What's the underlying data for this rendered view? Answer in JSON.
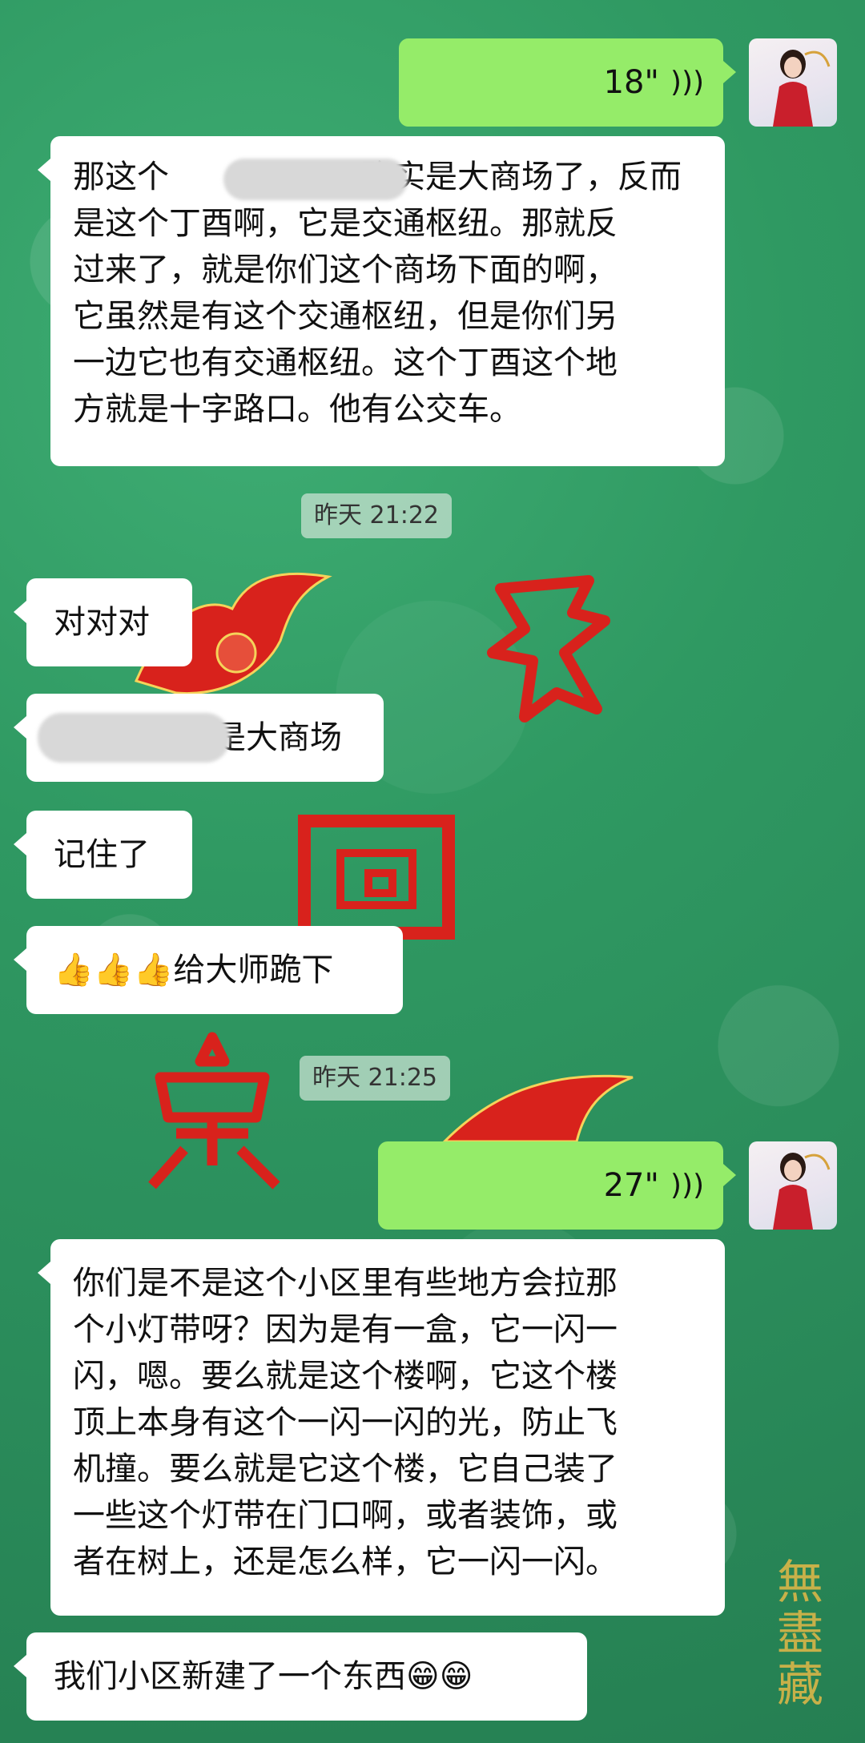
{
  "chat": {
    "messages": [
      {
        "side": "sent",
        "type": "voice",
        "duration": "18\""
      },
      {
        "side": "recv",
        "type": "text",
        "text": "那这个确实是大商场了，反而是这个丁酉啊，它是交通枢纽。那就反过来了，就是你们这个商场下面的啊，它虽然是有这个交通枢纽，但是你们另一边它也有交通枢纽。这个丁酉这个地方就是十字路口。他有公交车。"
      },
      {
        "side": "time",
        "text": "昨天 21:22"
      },
      {
        "side": "recv",
        "type": "text",
        "text": "对对对"
      },
      {
        "side": "recv",
        "type": "text",
        "text": "是大商场"
      },
      {
        "side": "recv",
        "type": "text",
        "text": "记住了"
      },
      {
        "side": "recv",
        "type": "text",
        "text": "给大师跪下"
      },
      {
        "side": "time",
        "text": "昨天 21:25"
      },
      {
        "side": "sent",
        "type": "voice",
        "duration": "27\""
      },
      {
        "side": "recv",
        "type": "text",
        "text": "你们是不是这个小区里有些地方会拉那个小灯带呀？因为是有一盒，它一闪一闪，嗯。要么就是这个楼啊，它这个楼顶上本身有这个一闪一闪的光，防止飞机撞。要么就是它这个楼，它自己装了一些这个灯带在门口啊，或者装饰，或者在树上，还是怎么样，它一闪一闪。"
      },
      {
        "side": "recv",
        "type": "text",
        "text": "我们小区新建了一个东西"
      }
    ],
    "msg1_lines": [
      "那这个",
      "确实是大商场了，反而",
      "是这个丁酉啊，它是交通枢纽。那就反",
      "过来了，就是你们这个商场下面的啊，",
      "它虽然是有这个交通枢纽，但是你们另",
      "一边它也有交通枢纽。这个丁酉这个地",
      "方就是十字路口。他有公交车。"
    ],
    "msg9_lines": [
      "你们是不是这个小区里有些地方会拉那",
      "个小灯带呀？因为是有一盒，它一闪一",
      "闪，嗯。要么就是这个楼啊，它这个楼",
      "顶上本身有这个一闪一闪的光，防止飞",
      "机撞。要么就是它这个楼，它自己装了",
      "一些这个灯带在门口啊，或者装饰，或",
      "者在树上，还是怎么样，它一闪一闪。"
    ],
    "emoji": {
      "thumbs": "👍👍👍",
      "grin": "😁😁"
    },
    "watermark": "無盡藏"
  },
  "colors": {
    "sent_bubble": "#95ec69",
    "recv_bubble": "#ffffff",
    "background": "#2f9962",
    "seal_red": "#d8221c"
  }
}
